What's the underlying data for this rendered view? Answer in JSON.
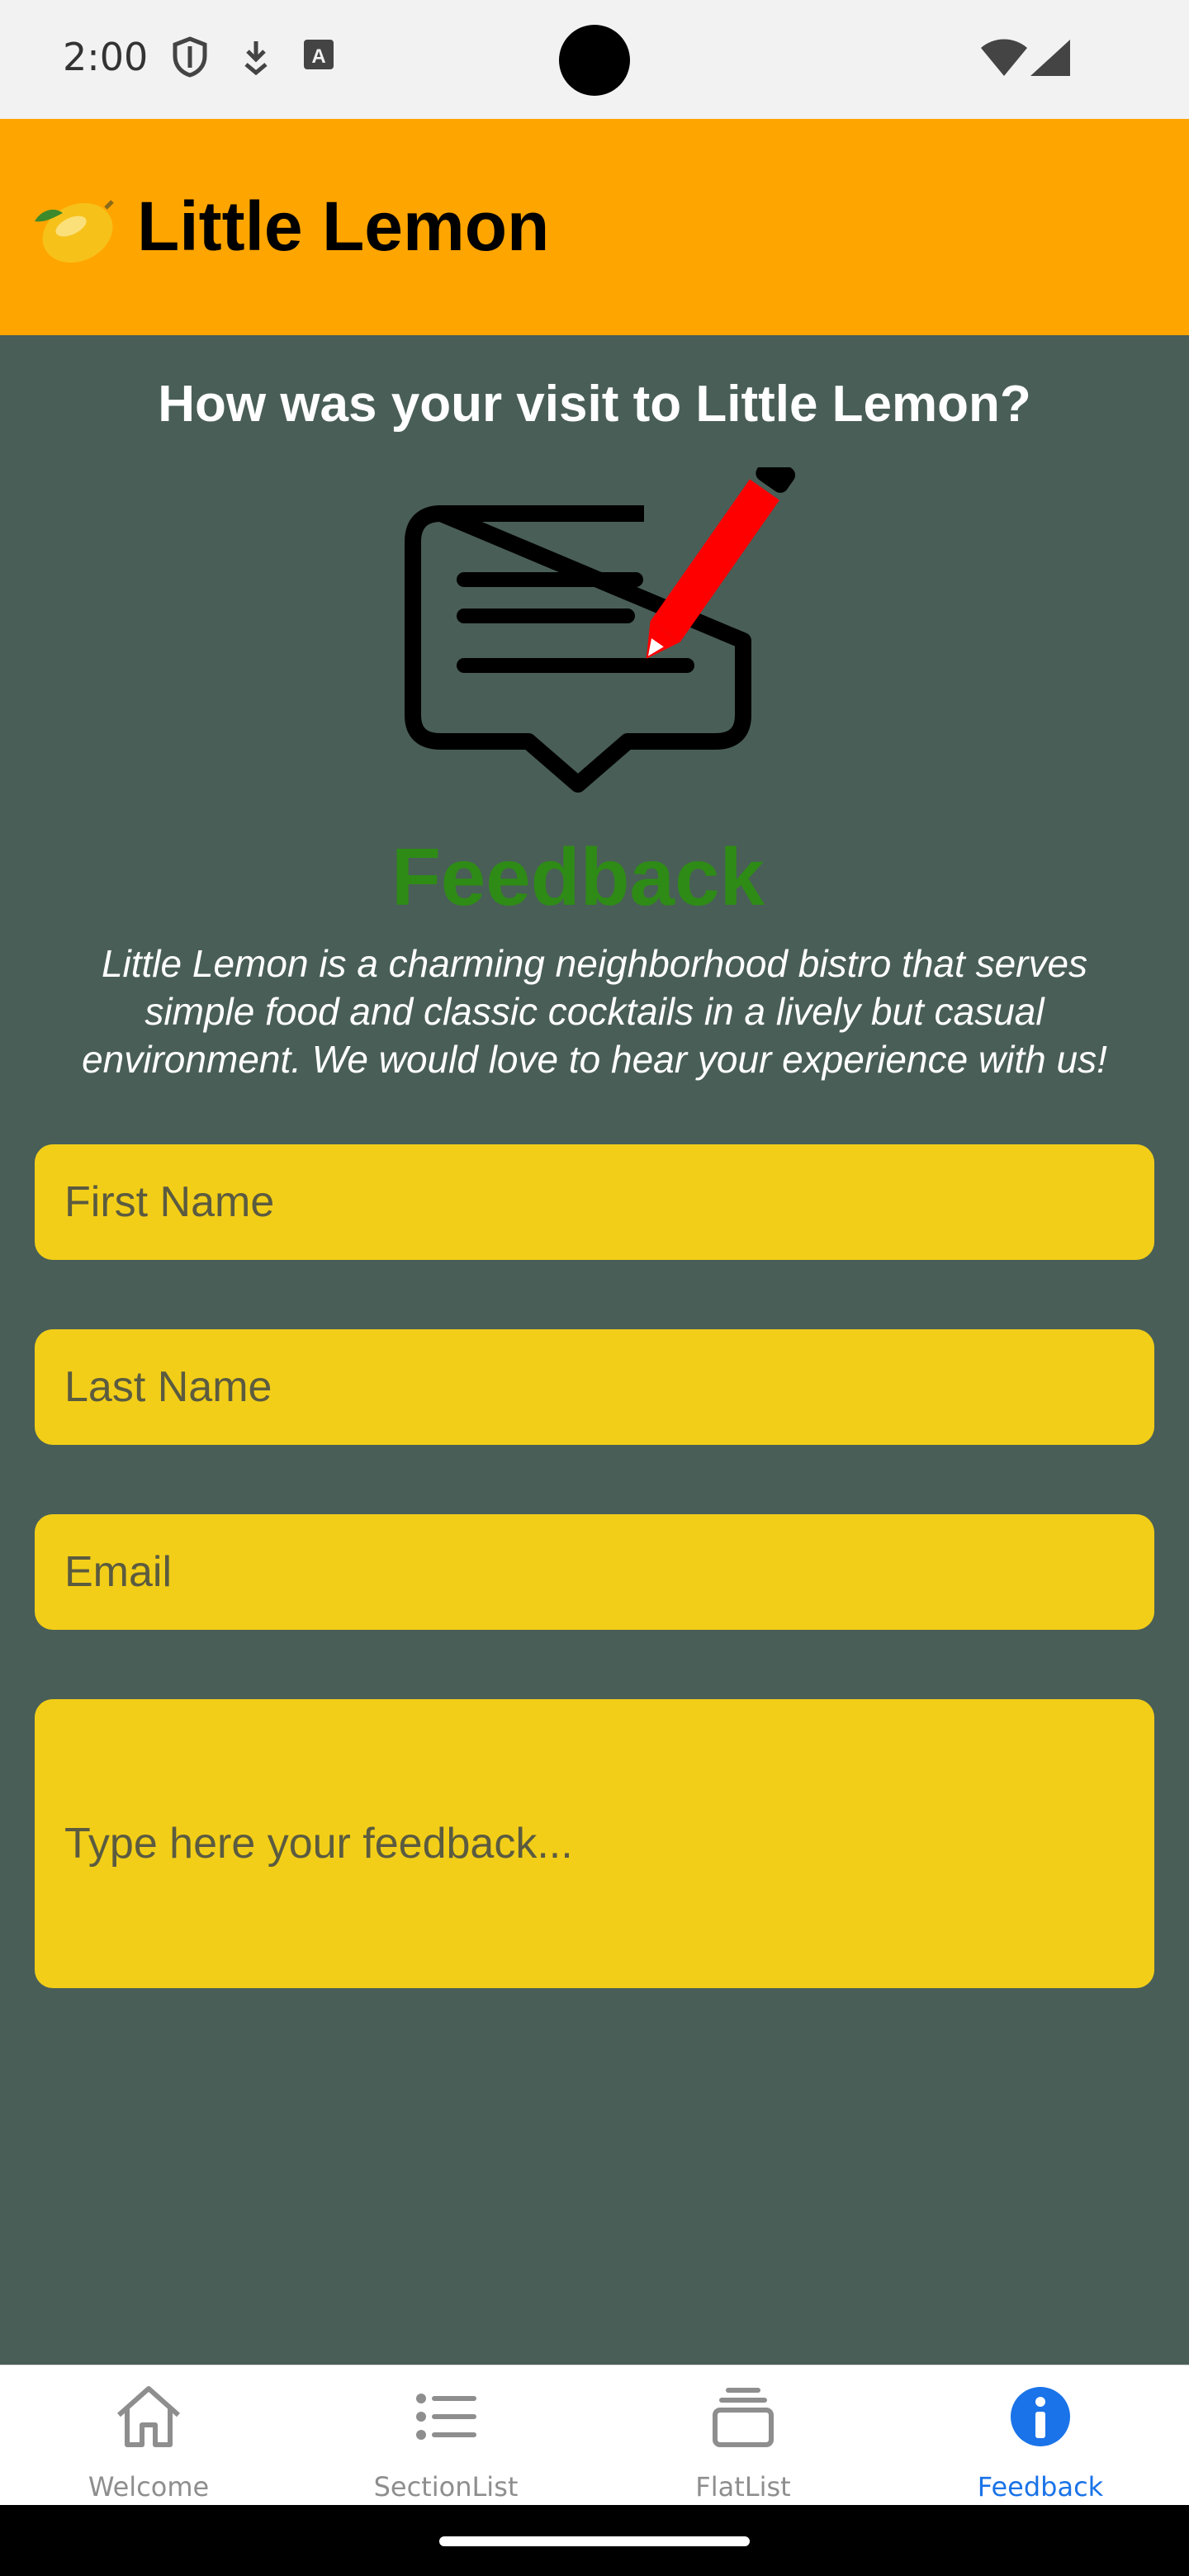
{
  "status_bar": {
    "time": "2:00",
    "icons": [
      "shield-icon",
      "download-icon",
      "keyboard-icon",
      "wifi-icon",
      "signal-icon"
    ]
  },
  "app_bar": {
    "logo_icon": "lemon-icon",
    "title": "Little Lemon"
  },
  "feedback": {
    "question": "How was your visit to Little Lemon?",
    "art_word": "Feedback",
    "intro": "Little Lemon is a charming neighborhood bistro that serves simple food and classic cocktails in a lively but casual environment. We would love to hear your experience with us!",
    "fields": {
      "first_name_placeholder": "First Name",
      "last_name_placeholder": "Last Name",
      "email_placeholder": "Email",
      "message_placeholder": "Type here your feedback..."
    }
  },
  "tabs": [
    {
      "label": "Welcome",
      "icon": "home-icon",
      "active": false
    },
    {
      "label": "SectionList",
      "icon": "list-icon",
      "active": false
    },
    {
      "label": "FlatList",
      "icon": "stack-icon",
      "active": false
    },
    {
      "label": "Feedback",
      "icon": "info-icon",
      "active": true
    }
  ],
  "colors": {
    "app_bar": "#ffa500",
    "background": "#495e57",
    "field": "#f2ce18",
    "feedback_word": "#2e8b16",
    "tab_active": "#1a73e8",
    "tab_inactive": "#8e8e8e"
  }
}
